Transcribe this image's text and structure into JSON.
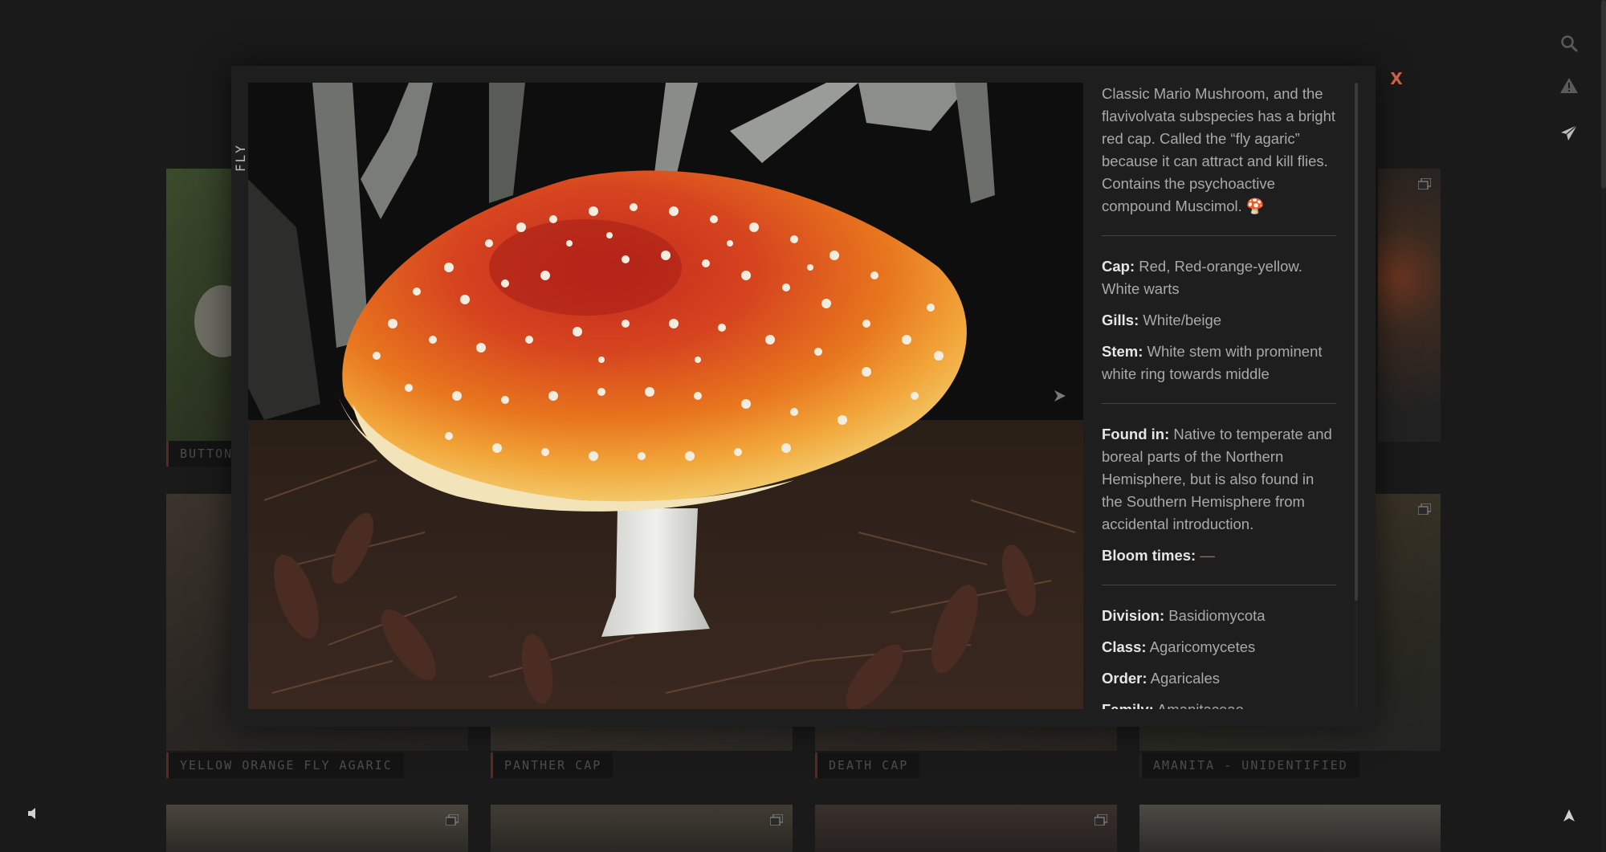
{
  "gallery": {
    "labels": {
      "button": "BUTTON",
      "yellow_orange": "YELLOW ORANGE FLY AGARIC",
      "panther": "PANTHER CAP",
      "death": "DEATH CAP",
      "amanita": "AMANITA - UNIDENTIFIED"
    }
  },
  "modal": {
    "title": "FLY AGARIC",
    "close_label": "X",
    "description": "Classic Mario Mushroom, and the flavivolvata subspecies has a bright red cap. Called the “fly agaric” because it can attract and kill flies. Contains the psychoactive compound Muscimol. 🍄",
    "traits": [
      {
        "label": "Cap:",
        "value": "Red, Red-orange-yellow. White warts"
      },
      {
        "label": "Gills:",
        "value": "White/beige"
      },
      {
        "label": "Stem:",
        "value": "White stem with prominent white ring towards middle"
      }
    ],
    "habitat": {
      "label": "Found in:",
      "value": "Native to temperate and boreal parts of the Northern Hemisphere, but is also found in the Southern Hemisphere from accidental introduction."
    },
    "bloom": {
      "label": "Bloom times:",
      "value": "—"
    },
    "taxonomy": [
      {
        "label": "Division:",
        "value": "Basidiomycota"
      },
      {
        "label": "Class:",
        "value": "Agaricomycetes"
      },
      {
        "label": "Order:",
        "value": "Agaricales"
      },
      {
        "label": "Family:",
        "value": "Amanitaceae"
      }
    ]
  },
  "icons": {
    "rail": [
      "search-icon",
      "warning-icon",
      "send-icon"
    ],
    "sound": "speaker-icon",
    "top": "arrow-up-icon",
    "next": "next-arrow-icon"
  },
  "colors": {
    "background": "#1a1a1a",
    "accent": "#c7614a",
    "text": "#a9a9a9",
    "label": "#e6e6e6"
  }
}
